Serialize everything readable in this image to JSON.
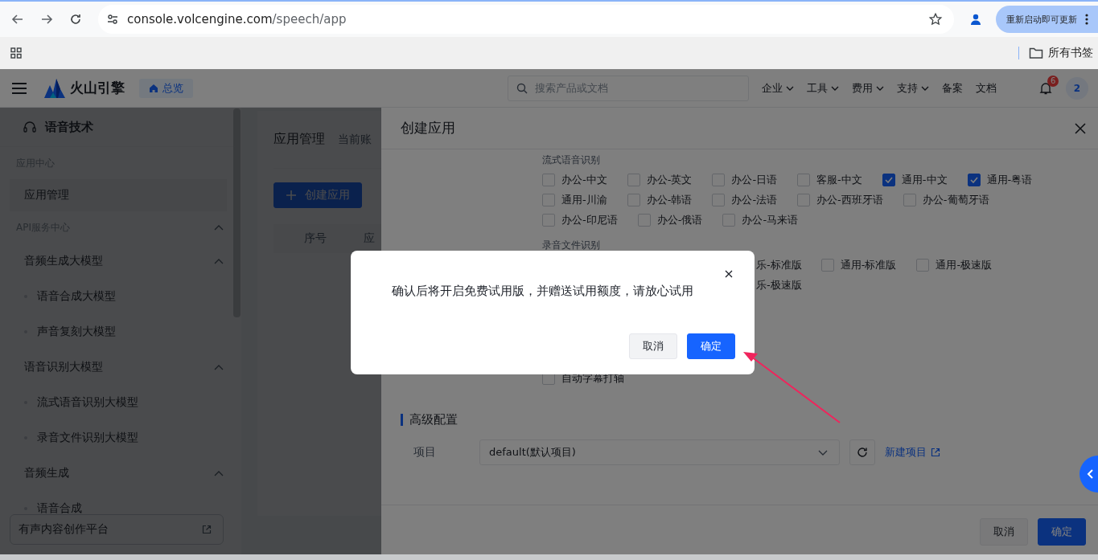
{
  "browser": {
    "url_host": "console.volcengine.com",
    "url_path": "/speech/app",
    "update_button": "重新启动即可更新",
    "bookmarks_folder": "所有书签"
  },
  "top_nav": {
    "logo": "火山引擎",
    "overview": "总览",
    "search_placeholder": "搜索产品或文档",
    "menus": [
      {
        "label": "企业",
        "dropdown": true
      },
      {
        "label": "工具",
        "dropdown": true
      },
      {
        "label": "费用",
        "dropdown": true
      },
      {
        "label": "支持",
        "dropdown": true
      },
      {
        "label": "备案",
        "dropdown": false
      },
      {
        "label": "文档",
        "dropdown": false
      }
    ],
    "notification_count": "6",
    "avatar": "2"
  },
  "sidebar": {
    "title": "语音技术",
    "menu": [
      {
        "kind": "header",
        "label": "应用中心"
      },
      {
        "kind": "link",
        "label": "应用管理",
        "selected": true
      },
      {
        "kind": "header",
        "label": "API服务中心",
        "expanded": true,
        "children": [
          {
            "kind": "submenu",
            "label": "音频生成大模型",
            "expanded": true,
            "children": [
              {
                "kind": "leaf",
                "label": "语音合成大模型",
                "selected": false
              },
              {
                "kind": "leaf",
                "label": "声音复刻大模型",
                "selected": false
              }
            ]
          },
          {
            "kind": "submenu",
            "label": "语音识别大模型",
            "expanded": true,
            "children": [
              {
                "kind": "leaf",
                "label": "流式语音识别大模型",
                "selected": false
              },
              {
                "kind": "leaf",
                "label": "录音文件识别大模型",
                "selected": false
              }
            ]
          },
          {
            "kind": "submenu",
            "label": "音频生成",
            "expanded": true,
            "children": [
              {
                "kind": "leaf",
                "label": "语音合成",
                "selected": false
              }
            ]
          }
        ]
      }
    ],
    "footer_link": "有声内容创作平台"
  },
  "main": {
    "title": "应用管理",
    "subtitle": "当前账",
    "create_button": "创建应用",
    "table_columns": [
      "序号",
      "应"
    ]
  },
  "drawer": {
    "title": "创建应用",
    "sections": [
      {
        "label": "流式语音识别",
        "rows": [
          [
            {
              "kind": "checkbox",
              "label": "办公-中文",
              "checked": false
            },
            {
              "kind": "checkbox",
              "label": "办公-英文",
              "checked": false
            },
            {
              "kind": "checkbox",
              "label": "办公-日语",
              "checked": false
            },
            {
              "kind": "checkbox",
              "label": "客服-中文",
              "checked": false
            },
            {
              "kind": "checkbox",
              "label": "通用-中文",
              "checked": true
            },
            {
              "kind": "checkbox",
              "label": "通用-粤语",
              "checked": true
            }
          ],
          [
            {
              "kind": "checkbox",
              "label": "通用-川渝",
              "checked": false
            },
            {
              "kind": "checkbox",
              "label": "办公-韩语",
              "checked": false
            },
            {
              "kind": "checkbox",
              "label": "办公-法语",
              "checked": false
            },
            {
              "kind": "checkbox",
              "label": "办公-西班牙语",
              "checked": false
            },
            {
              "kind": "checkbox",
              "label": "办公-葡萄牙语",
              "checked": false
            }
          ],
          [
            {
              "kind": "checkbox",
              "label": "办公-印尼语",
              "checked": false
            },
            {
              "kind": "checkbox",
              "label": "办公-俄语",
              "checked": false
            },
            {
              "kind": "checkbox",
              "label": "办公-马来语",
              "checked": false
            }
          ]
        ]
      },
      {
        "label": "录音文件识别",
        "rows": [
          [
            {
              "kind": "fragment",
              "label": "乐-标准版"
            },
            {
              "kind": "checkbox",
              "label": "通用-标准版",
              "checked": false
            },
            {
              "kind": "checkbox",
              "label": "通用-极速版",
              "checked": false
            }
          ],
          [
            {
              "kind": "fragment",
              "label": "乐-极速版"
            }
          ]
        ]
      },
      {
        "rows": [
          [
            {
              "kind": "checkbox",
              "label": "自动字幕打轴",
              "checked": false
            }
          ]
        ]
      }
    ],
    "advanced": {
      "title": "高级配置",
      "project_label": "项目",
      "project_value": "default(默认项目)",
      "new_project_link": "新建项目"
    },
    "footer_buttons": [
      {
        "label": "取消",
        "kind": "secondary"
      },
      {
        "label": "确定",
        "kind": "primary"
      }
    ]
  },
  "modal": {
    "message": "确认后将开启免费试用版，并赠送试用额度，请放心试用",
    "buttons": [
      {
        "label": "取消",
        "kind": "secondary"
      },
      {
        "label": "确定",
        "kind": "primary"
      }
    ]
  },
  "annotations": [
    {
      "kind": "arrow"
    }
  ]
}
